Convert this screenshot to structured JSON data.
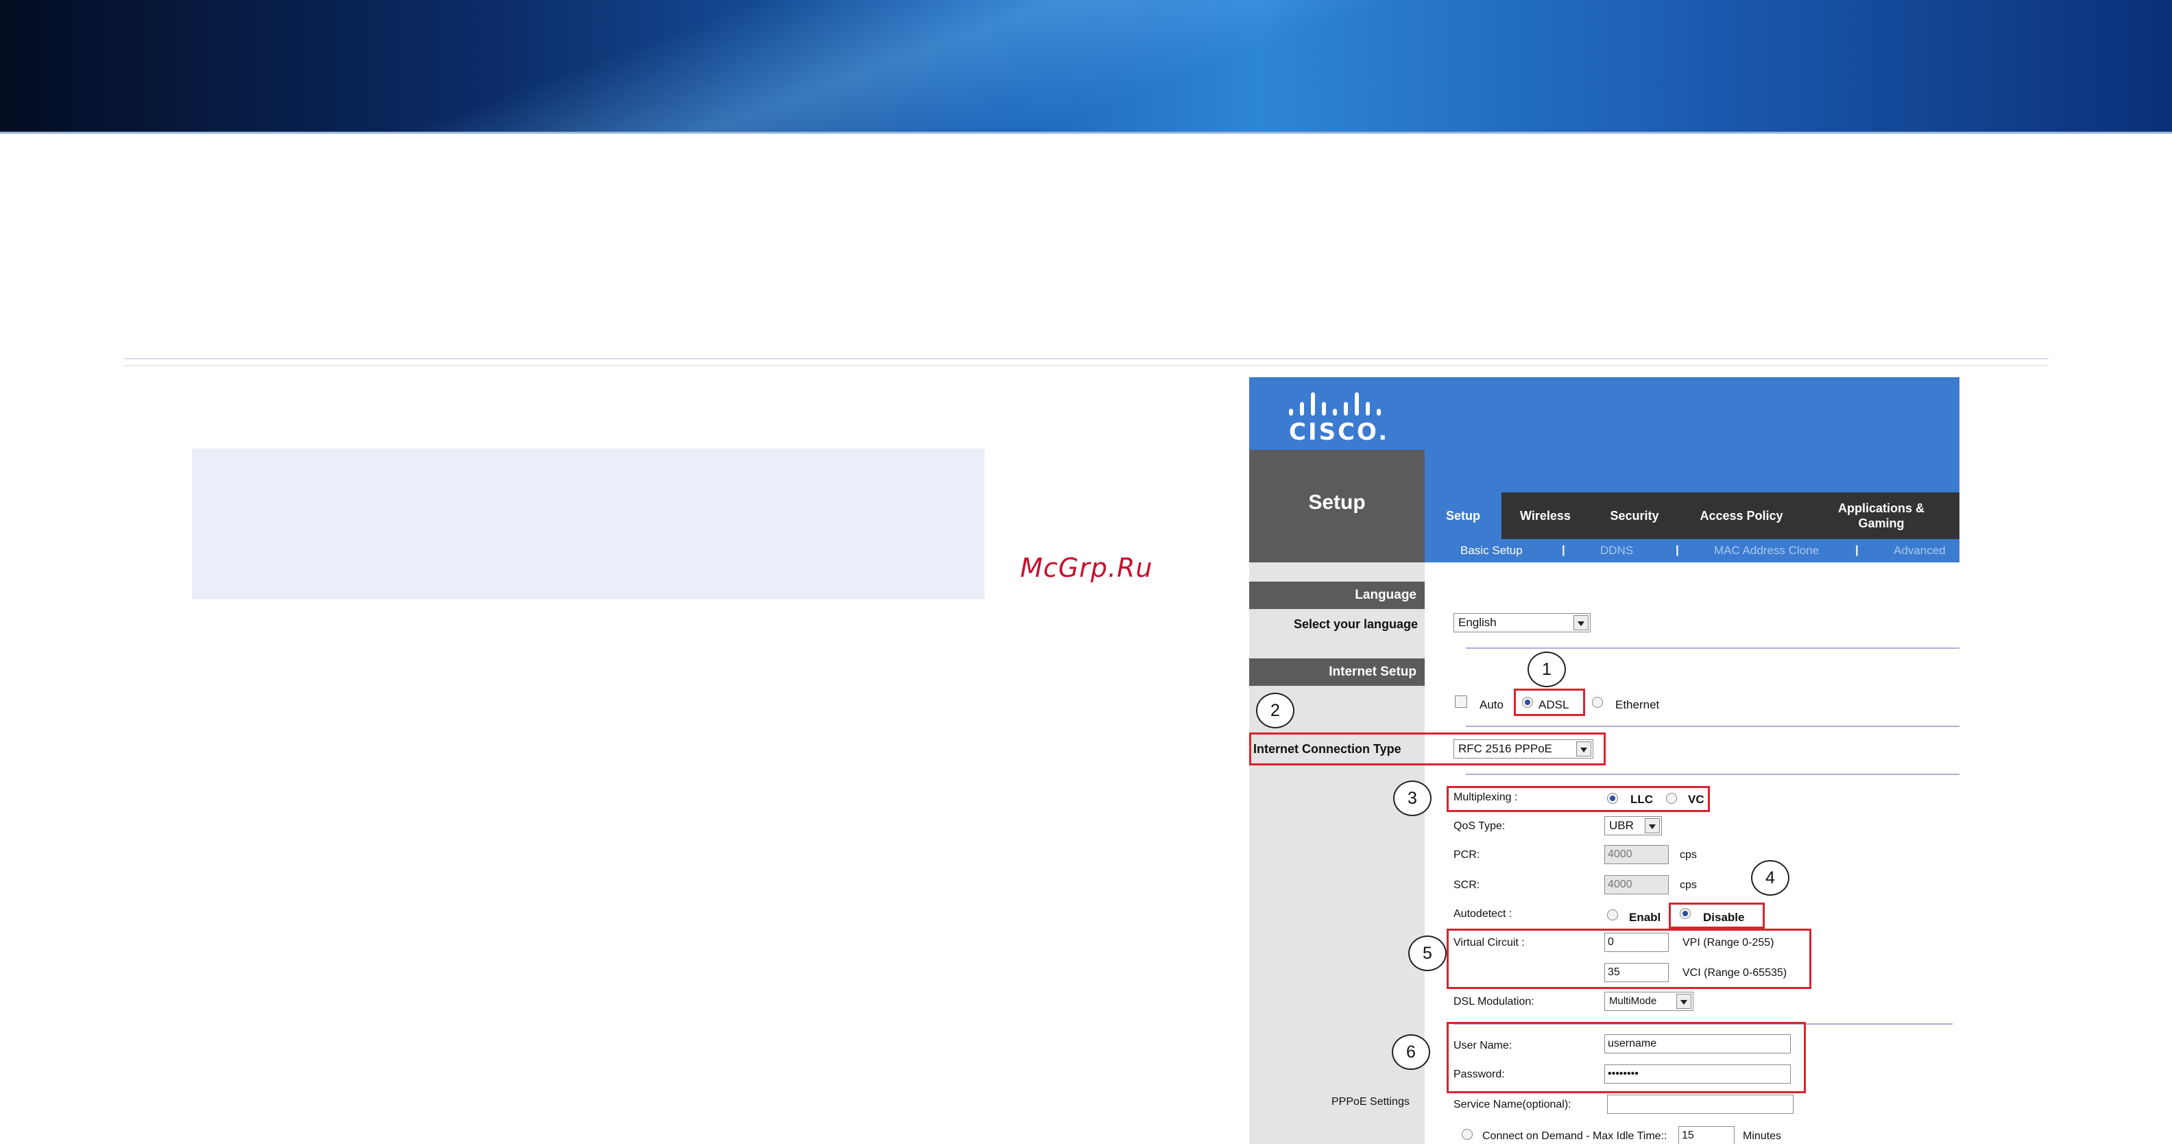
{
  "watermark": "McGrp.Ru",
  "router": {
    "logo_text": "CISCO.",
    "section_title": "Setup",
    "tabs": [
      "Setup",
      "Wireless",
      "Security",
      "Access Policy",
      "Applications &\nGaming"
    ],
    "subnav": [
      "Basic Setup",
      "DDNS",
      "MAC Address Clone",
      "Advanced"
    ],
    "language_head": "Language",
    "select_language_label": "Select your language",
    "language_value": "English",
    "internet_setup_head": "Internet Setup",
    "modes": {
      "auto": "Auto",
      "adsl": "ADSL",
      "ethernet": "Ethernet"
    },
    "conn_type_label": "Internet Connection Type",
    "conn_type_value": "RFC 2516 PPPoE",
    "multiplexing_label": "Multiplexing :",
    "llc": "LLC",
    "vc": "VC",
    "qos_label": "QoS Type:",
    "qos_value": "UBR",
    "pcr_label": "PCR:",
    "pcr_value": "4000",
    "scr_label": "SCR:",
    "scr_value": "4000",
    "cps": "cps",
    "autodetect_label": "Autodetect :",
    "enable": "Enable",
    "disable": "Disable",
    "virtual_circuit_label": "Virtual Circuit :",
    "vpi_value": "0",
    "vpi_range": "VPI (Range 0-255)",
    "vci_value": "35",
    "vci_range": "VCI (Range 0-65535)",
    "dsl_mod_label": "DSL Modulation:",
    "dsl_mod_value": "MultiMode",
    "username_label": "User Name:",
    "username_value": "username",
    "password_label": "Password:",
    "password_value": "••••••••",
    "pppoe_settings_label": "PPPoE Settings",
    "service_name_label": "Service Name(optional):",
    "connect_demand_label": "Connect on Demand - Max Idle Time::",
    "idle_value": "15",
    "minutes": "Minutes"
  },
  "callouts": [
    "1",
    "2",
    "3",
    "4",
    "5",
    "6"
  ],
  "colors": {
    "accent": "#3b7bd0",
    "callout": "#d9232e",
    "dark_tab": "#333333"
  }
}
